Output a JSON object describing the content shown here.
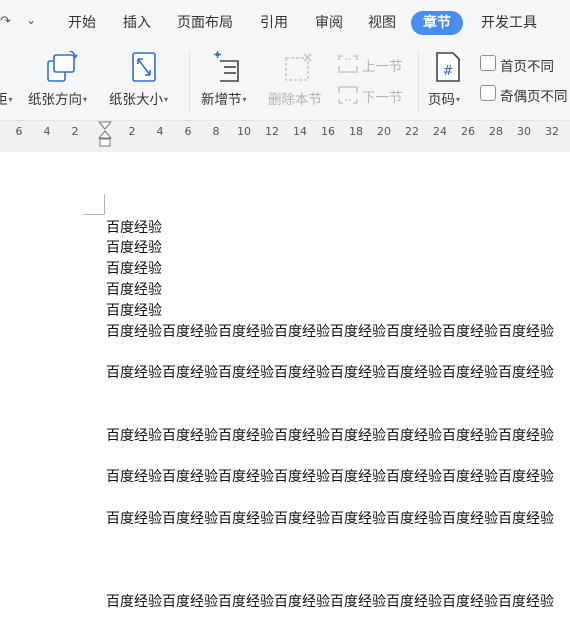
{
  "tabs": [
    {
      "label": "开始"
    },
    {
      "label": "插入"
    },
    {
      "label": "页面布局"
    },
    {
      "label": "引用"
    },
    {
      "label": "审阅"
    },
    {
      "label": "视图"
    },
    {
      "label": "章节"
    },
    {
      "label": "开发工具"
    }
  ],
  "active_tab": "章节",
  "ribbon": {
    "margin_label": "距",
    "orientation_label": "纸张方向",
    "size_label": "纸张大小",
    "new_section_label": "新增节",
    "delete_section_label": "删除本节",
    "prev_section_label": "上一节",
    "next_section_label": "下一节",
    "page_number_label": "页码",
    "first_page_diff_label": "首页不同",
    "odd_even_diff_label": "奇偶页不同"
  },
  "ruler": {
    "left_ticks": [
      "6",
      "4",
      "2"
    ],
    "right_ticks": [
      "2",
      "4",
      "6",
      "8",
      "10",
      "12",
      "14",
      "16",
      "18",
      "20",
      "22",
      "24",
      "26",
      "28",
      "30",
      "32"
    ]
  },
  "document": {
    "lines": [
      "百度经验",
      "百度经验",
      "百度经验",
      "百度经验",
      "百度经验",
      "百度经验百度经验百度经验百度经验百度经验百度经验百度经验百度经验",
      "百度经验百度经验百度经验百度经验百度经验百度经验百度经验百度经验",
      "百度经验百度经验百度经验百度经验百度经验百度经验百度经验百度经验",
      "百度经验百度经验百度经验百度经验百度经验百度经验百度经验百度经验",
      "百度经验百度经验百度经验百度经验百度经验百度经验百度经验百度经验",
      "百度经验百度经验百度经验百度经验百度经验百度经验百度经验百度经验"
    ]
  },
  "colors": {
    "accent": "#4a8cf0",
    "icon_blue": "#2f6fd6",
    "disabled": "#b0b5bb"
  }
}
